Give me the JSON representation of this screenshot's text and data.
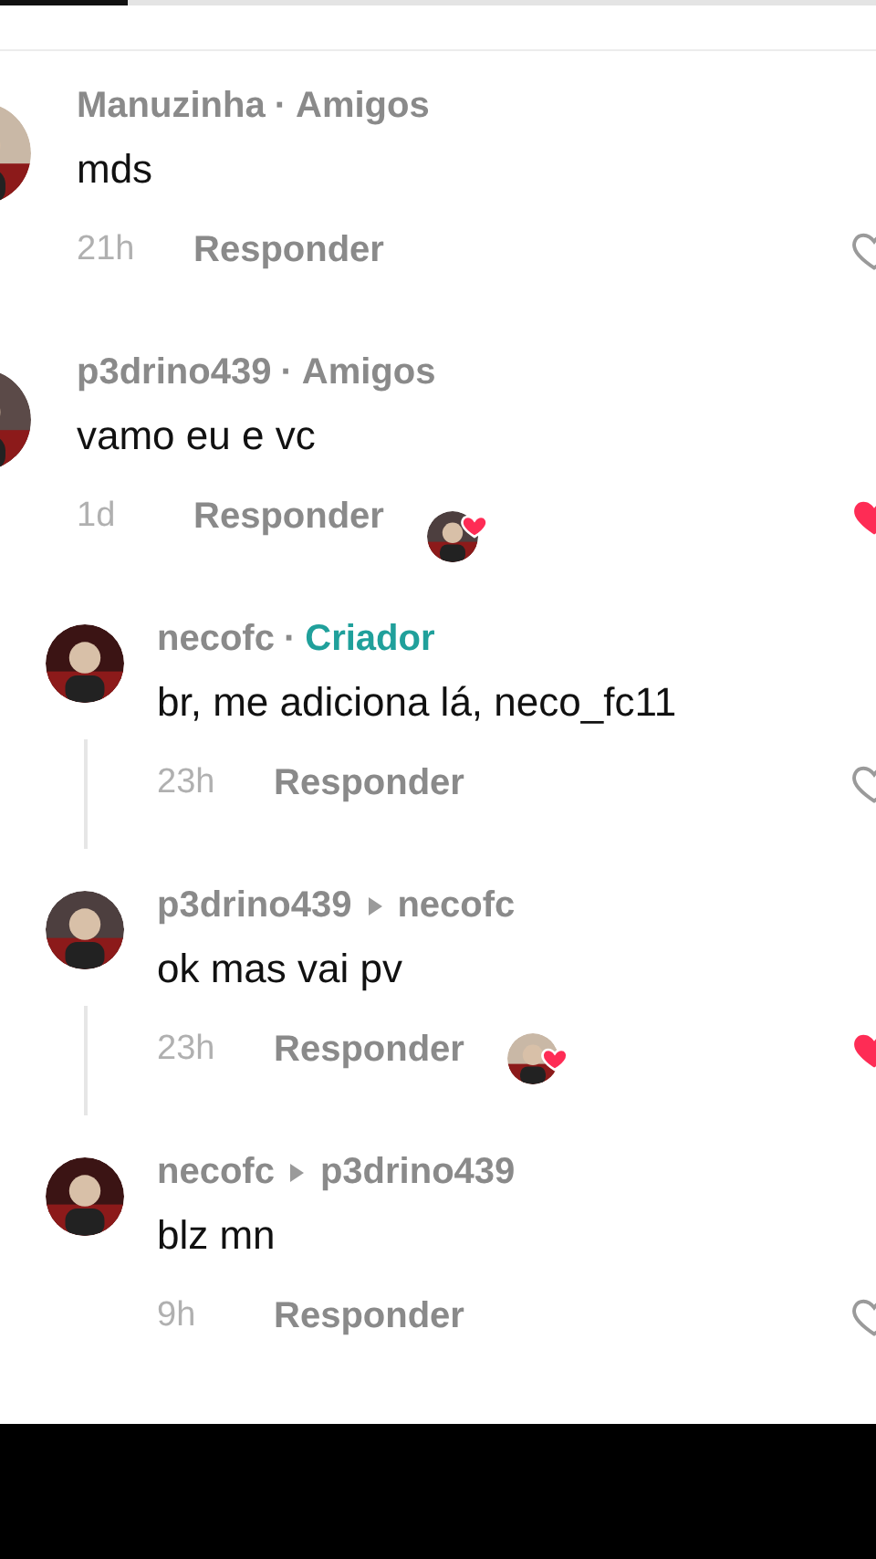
{
  "progress_bar": {
    "level": 0.146
  },
  "comments": [
    {
      "kind": "comment",
      "author": "Manuzinha",
      "relation": {
        "separator": "·",
        "label": "Amigos",
        "kind": "friend"
      },
      "text": "mds",
      "time": "21h",
      "reply_label": "Responder",
      "creator_liked": false,
      "liked": false,
      "thread_line": false
    },
    {
      "kind": "comment",
      "author": "p3drino439",
      "relation": {
        "separator": "·",
        "label": "Amigos",
        "kind": "friend"
      },
      "text": "vamo eu e vc",
      "time": "1d",
      "reply_label": "Responder",
      "creator_liked": true,
      "liked": true,
      "thread_line": false
    },
    {
      "kind": "reply",
      "author": "necofc",
      "relation": {
        "separator": "·",
        "label": "Criador",
        "kind": "creator"
      },
      "text": "br, me adiciona lá, neco_fc11",
      "time": "23h",
      "reply_label": "Responder",
      "creator_liked": false,
      "liked": false,
      "thread_line": true
    },
    {
      "kind": "reply",
      "author": "p3drino439",
      "reply_to": "necofc",
      "text": "ok mas vai pv",
      "time": "23h",
      "reply_label": "Responder",
      "creator_liked": true,
      "liked": true,
      "thread_line": true
    },
    {
      "kind": "reply",
      "author": "necofc",
      "reply_to": "p3drino439",
      "text": "blz mn",
      "time": "9h",
      "reply_label": "Responder",
      "creator_liked": false,
      "liked": false,
      "thread_line": false
    }
  ]
}
